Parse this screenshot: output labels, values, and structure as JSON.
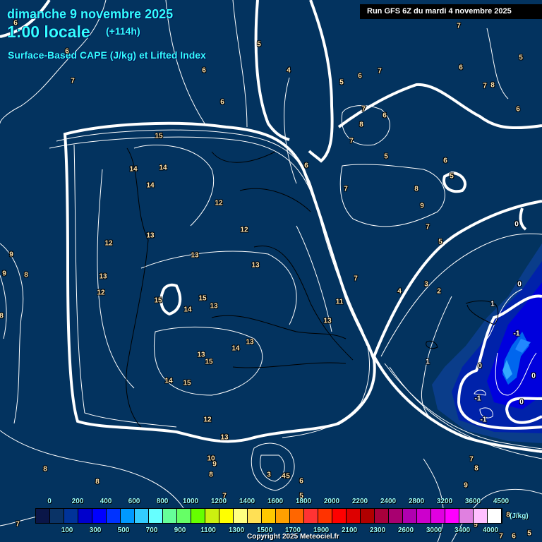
{
  "header": {
    "date": "dimanche 9 novembre 2025",
    "time": "1:00 locale",
    "lead": "(+114h)",
    "parameter": "Surface-Based CAPE (J/kg) et Lifted Index",
    "run": "Run GFS 6Z du mardi 4 novembre 2025"
  },
  "legend": {
    "unit": "(J/kg)",
    "colors": [
      "#0a1648",
      "#0a3366",
      "#003399",
      "#0000cc",
      "#0000ff",
      "#0033ff",
      "#0099ff",
      "#33ccff",
      "#66ffff",
      "#66ff99",
      "#66ff66",
      "#66ff00",
      "#ccf010",
      "#ffff00",
      "#ffff80",
      "#ffe055",
      "#ffc800",
      "#ffa000",
      "#ff6600",
      "#ff3333",
      "#ff3300",
      "#ff0000",
      "#dd0000",
      "#b00000",
      "#a8003c",
      "#a80070",
      "#b000b0",
      "#cc00cc",
      "#e000e0",
      "#ff00ff",
      "#e080e0",
      "#ffc0ff",
      "#ffffff"
    ],
    "top_labels": [
      "0",
      "200",
      "400",
      "600",
      "800",
      "1000",
      "1200",
      "1400",
      "1600",
      "1800",
      "2000",
      "2200",
      "2400",
      "2800",
      "3200",
      "3600",
      "4500"
    ],
    "bottom_labels": [
      "100",
      "300",
      "500",
      "700",
      "900",
      "1100",
      "1300",
      "1500",
      "1700",
      "1900",
      "2100",
      "2300",
      "2600",
      "3000",
      "3400",
      "4000"
    ]
  },
  "contour_labels": [
    "6",
    "7",
    "5",
    "5",
    "6",
    "6",
    "4",
    "5",
    "6",
    "7",
    "6",
    "7",
    "8",
    "7",
    "6",
    "7",
    "6",
    "8",
    "7",
    "6",
    "15",
    "14",
    "14",
    "14",
    "5",
    "6",
    "6",
    "5",
    "7",
    "8",
    "9",
    "12",
    "12",
    "7",
    "0",
    "5",
    "13",
    "12",
    "9",
    "9",
    "8",
    "13",
    "13",
    "13",
    "7",
    "3",
    "2",
    "4",
    "0",
    "12",
    "15",
    "15",
    "14",
    "13",
    "11",
    "1",
    "8",
    "13",
    "-1",
    "14",
    "13",
    "13",
    "15",
    "1",
    "0",
    "14",
    "15",
    "0",
    "-1",
    "0",
    "12",
    "-1",
    "13",
    "7",
    "10",
    "9",
    "8",
    "8",
    "3",
    "4",
    "5",
    "8",
    "6",
    "8",
    "9",
    "7",
    "5",
    "8",
    "7",
    "9",
    "7",
    "6",
    "5"
  ],
  "copyright": "Copyright 2025 Meteociel.fr"
}
